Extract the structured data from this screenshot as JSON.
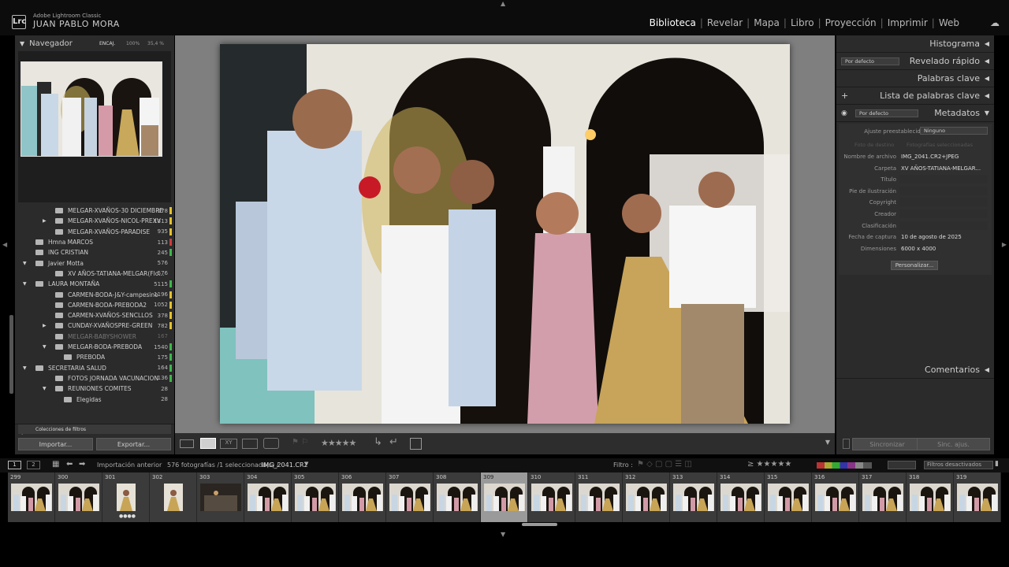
{
  "app": {
    "name": "Adobe Lightroom Classic",
    "user": "JUAN PABLO MORA",
    "logo": "Lrc"
  },
  "modules": [
    "Biblioteca",
    "Revelar",
    "Mapa",
    "Libro",
    "Proyección",
    "Imprimir",
    "Web"
  ],
  "active_module": "Biblioteca",
  "navigator": {
    "title": "Navegador",
    "zoom": [
      "ENCAJ.",
      "100%",
      "35,4 %"
    ]
  },
  "folders": [
    {
      "name": "MELGAR-XVAÑOS-30 DICIEMBRE",
      "count": "578",
      "indent": 1,
      "tri": "",
      "color": "#e5c22a"
    },
    {
      "name": "MELGAR-XVAÑOS-NICOL-PREXV",
      "count": "1313",
      "indent": 1,
      "tri": "▶",
      "color": "#e5c22a"
    },
    {
      "name": "MELGAR-XVAÑOS-PARADISE",
      "count": "935",
      "indent": 1,
      "tri": "",
      "color": "#e5c22a"
    },
    {
      "name": "Hmna MARCOS",
      "count": "113",
      "indent": 0,
      "tri": "",
      "color": "#d13b3b"
    },
    {
      "name": "ING CRISTIAN",
      "count": "245",
      "indent": 0,
      "tri": "",
      "color": "#3cb84a"
    },
    {
      "name": "Javier Motta",
      "count": "576",
      "indent": 0,
      "tri": "▼",
      "color": ""
    },
    {
      "name": "XV AÑOS-TATIANA-MELGAR(Flo...",
      "count": "576",
      "indent": 1,
      "tri": "",
      "color": ""
    },
    {
      "name": "LAURA MONTAÑA",
      "count": "5115",
      "indent": 0,
      "tri": "▼",
      "color": "#3cb84a"
    },
    {
      "name": "CARMEN-BODA-J&Y-campesino",
      "count": "1196",
      "indent": 1,
      "tri": "",
      "color": "#e5c22a"
    },
    {
      "name": "CARMEN-BODA-PREBODA2",
      "count": "1052",
      "indent": 1,
      "tri": "",
      "color": "#e5c22a"
    },
    {
      "name": "CARMEN-XVAÑOS-SENCLLOS",
      "count": "378",
      "indent": 1,
      "tri": "",
      "color": "#e5c22a"
    },
    {
      "name": "CUNDAY-XVAÑOSPRE-GREEN",
      "count": "782",
      "indent": 1,
      "tri": "▶",
      "color": "#e5c22a"
    },
    {
      "name": "MELGAR-BABYSHOWER",
      "count": "167",
      "indent": 1,
      "tri": "",
      "color": "",
      "dim": true
    },
    {
      "name": "MELGAR-BODA-PREBODA",
      "count": "1540",
      "indent": 1,
      "tri": "▼",
      "color": "#3cb84a"
    },
    {
      "name": "PREBODA",
      "count": "175",
      "indent": 2,
      "tri": "",
      "color": "#3cb84a"
    },
    {
      "name": "SECRETARIA SALUD",
      "count": "164",
      "indent": 0,
      "tri": "▼",
      "color": "#3cb84a"
    },
    {
      "name": "FOTOS JORNADA VACUNACION",
      "count": "136",
      "indent": 1,
      "tri": "",
      "color": "#3cb84a"
    },
    {
      "name": "REUNIONES COMITES",
      "count": "28",
      "indent": 1,
      "tri": "▼",
      "color": ""
    },
    {
      "name": "Elegidas",
      "count": "28",
      "indent": 2,
      "tri": "",
      "color": ""
    }
  ],
  "collections": {
    "title": "Colecciones",
    "partial": "Colecciones de filtros"
  },
  "buttons": {
    "import": "Importar...",
    "export": "Exportar..."
  },
  "right_panels": {
    "histogram": "Histograma",
    "quick_develop": "Revelado rápido",
    "quick_develop_preset": "Por defecto",
    "keywords": "Palabras clave",
    "keyword_list": "Lista de palabras clave",
    "metadata": "Metadatos",
    "metadata_preset": "Por defecto",
    "comments": "Comentarios",
    "plus": "+"
  },
  "metadata": {
    "preset_label": "Ajuste preestablecido",
    "preset_value": "Ninguno",
    "btn_target": "Foto de destino",
    "btn_selected": "Fotografías seleccionadas",
    "fields": [
      {
        "label": "Nombre de archivo",
        "value": "IMG_2041.CR2+JPEG"
      },
      {
        "label": "Carpeta",
        "value": "XV AÑOS-TATIANA-MELGAR..."
      },
      {
        "label": "Título",
        "value": ""
      },
      {
        "label": "Pie de ilustración",
        "value": ""
      },
      {
        "label": "Copyright",
        "value": ""
      },
      {
        "label": "Creador",
        "value": ""
      },
      {
        "label": "Clasificación",
        "value": ""
      },
      {
        "label": "Fecha de captura",
        "value": "10 de agosto de 2025"
      },
      {
        "label": "Dimensiones",
        "value": "6000 x 4000"
      }
    ],
    "customize": "Personalizar..."
  },
  "sync": {
    "sync_meta": "Sincronizar",
    "sync_settings": "Sinc. ajus."
  },
  "filmbar": {
    "view1": "1",
    "view2": "2",
    "source": "Importación anterior",
    "info": "576 fotografías /1 seleccionada(s) /",
    "file": "IMG_2041.CR2",
    "filter_label": "Filtro :",
    "filter_state": "Filtros desactivados"
  },
  "filmstrip": [
    {
      "n": "299",
      "type": "wide"
    },
    {
      "n": "300",
      "type": "wide"
    },
    {
      "n": "301",
      "type": "tall",
      "dots": true
    },
    {
      "n": "302",
      "type": "tall"
    },
    {
      "n": "303",
      "type": "dark"
    },
    {
      "n": "304",
      "type": "wide"
    },
    {
      "n": "305",
      "type": "wide"
    },
    {
      "n": "306",
      "type": "wide"
    },
    {
      "n": "307",
      "type": "wide"
    },
    {
      "n": "308",
      "type": "wide"
    },
    {
      "n": "309",
      "type": "wide",
      "selected": true
    },
    {
      "n": "310",
      "type": "wide"
    },
    {
      "n": "311",
      "type": "wide"
    },
    {
      "n": "312",
      "type": "wide"
    },
    {
      "n": "313",
      "type": "wide"
    },
    {
      "n": "314",
      "type": "wide"
    },
    {
      "n": "315",
      "type": "wide"
    },
    {
      "n": "316",
      "type": "wide"
    },
    {
      "n": "317",
      "type": "wide"
    },
    {
      "n": "318",
      "type": "wide"
    },
    {
      "n": "319",
      "type": "wide"
    }
  ],
  "colors": {
    "accent": "#ffffff",
    "panel": "#2b2b2b",
    "center_bg": "#7f7f7f"
  }
}
